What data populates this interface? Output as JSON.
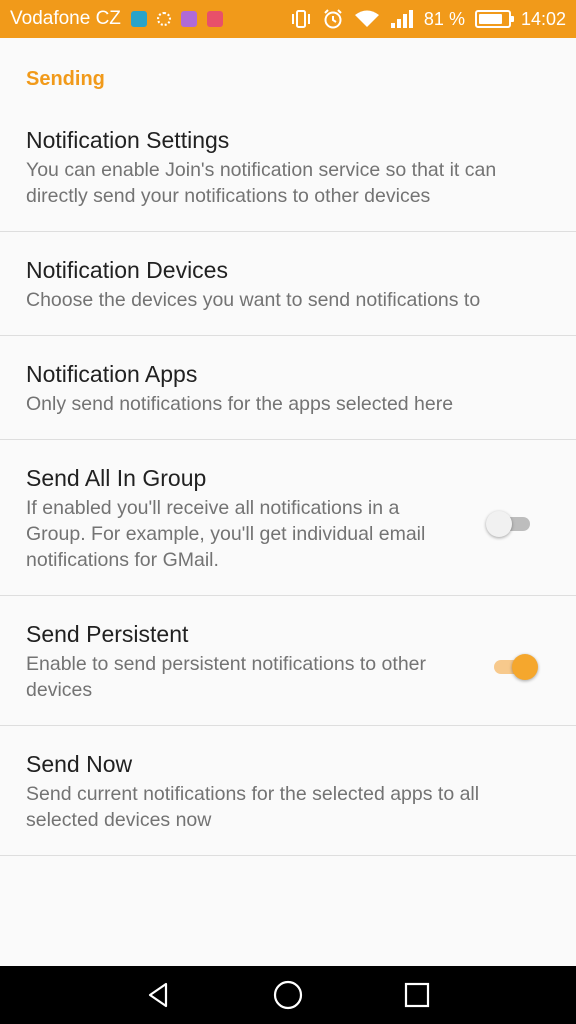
{
  "status_bar": {
    "carrier": "Vodafone CZ",
    "notification_icons": [
      "chat-bubble-icon",
      "settings-gear-icon",
      "gallery-icon",
      "gmail-icon"
    ],
    "battery_percent_text": "81 %",
    "battery_level": 0.81,
    "time": "14:02",
    "background_color": "#f19a1a"
  },
  "section": {
    "header": "Sending"
  },
  "preferences": [
    {
      "title": "Notification Settings",
      "summary": "You can enable Join's notification service so that it can directly send your notifications to other devices"
    },
    {
      "title": "Notification Devices",
      "summary": "Choose the devices you want to send notifications to"
    },
    {
      "title": "Notification Apps",
      "summary": "Only send notifications for the apps selected here"
    },
    {
      "title": "Send All In Group",
      "summary": "If enabled you'll receive all notifications in a Group. For example, you'll get individual email notifications for GMail.",
      "switch_on": false
    },
    {
      "title": "Send Persistent",
      "summary": "Enable to send persistent notifications to other devices",
      "switch_on": true
    },
    {
      "title": "Send Now",
      "summary": "Send current notifications for the selected apps to all selected devices now"
    }
  ],
  "nav_bar": {
    "buttons": [
      "back-icon",
      "home-icon",
      "recents-icon"
    ]
  },
  "colors": {
    "accent": "#f19a1a",
    "switch_on": "#f5a72d",
    "switch_off_track": "#bdbdbd"
  }
}
